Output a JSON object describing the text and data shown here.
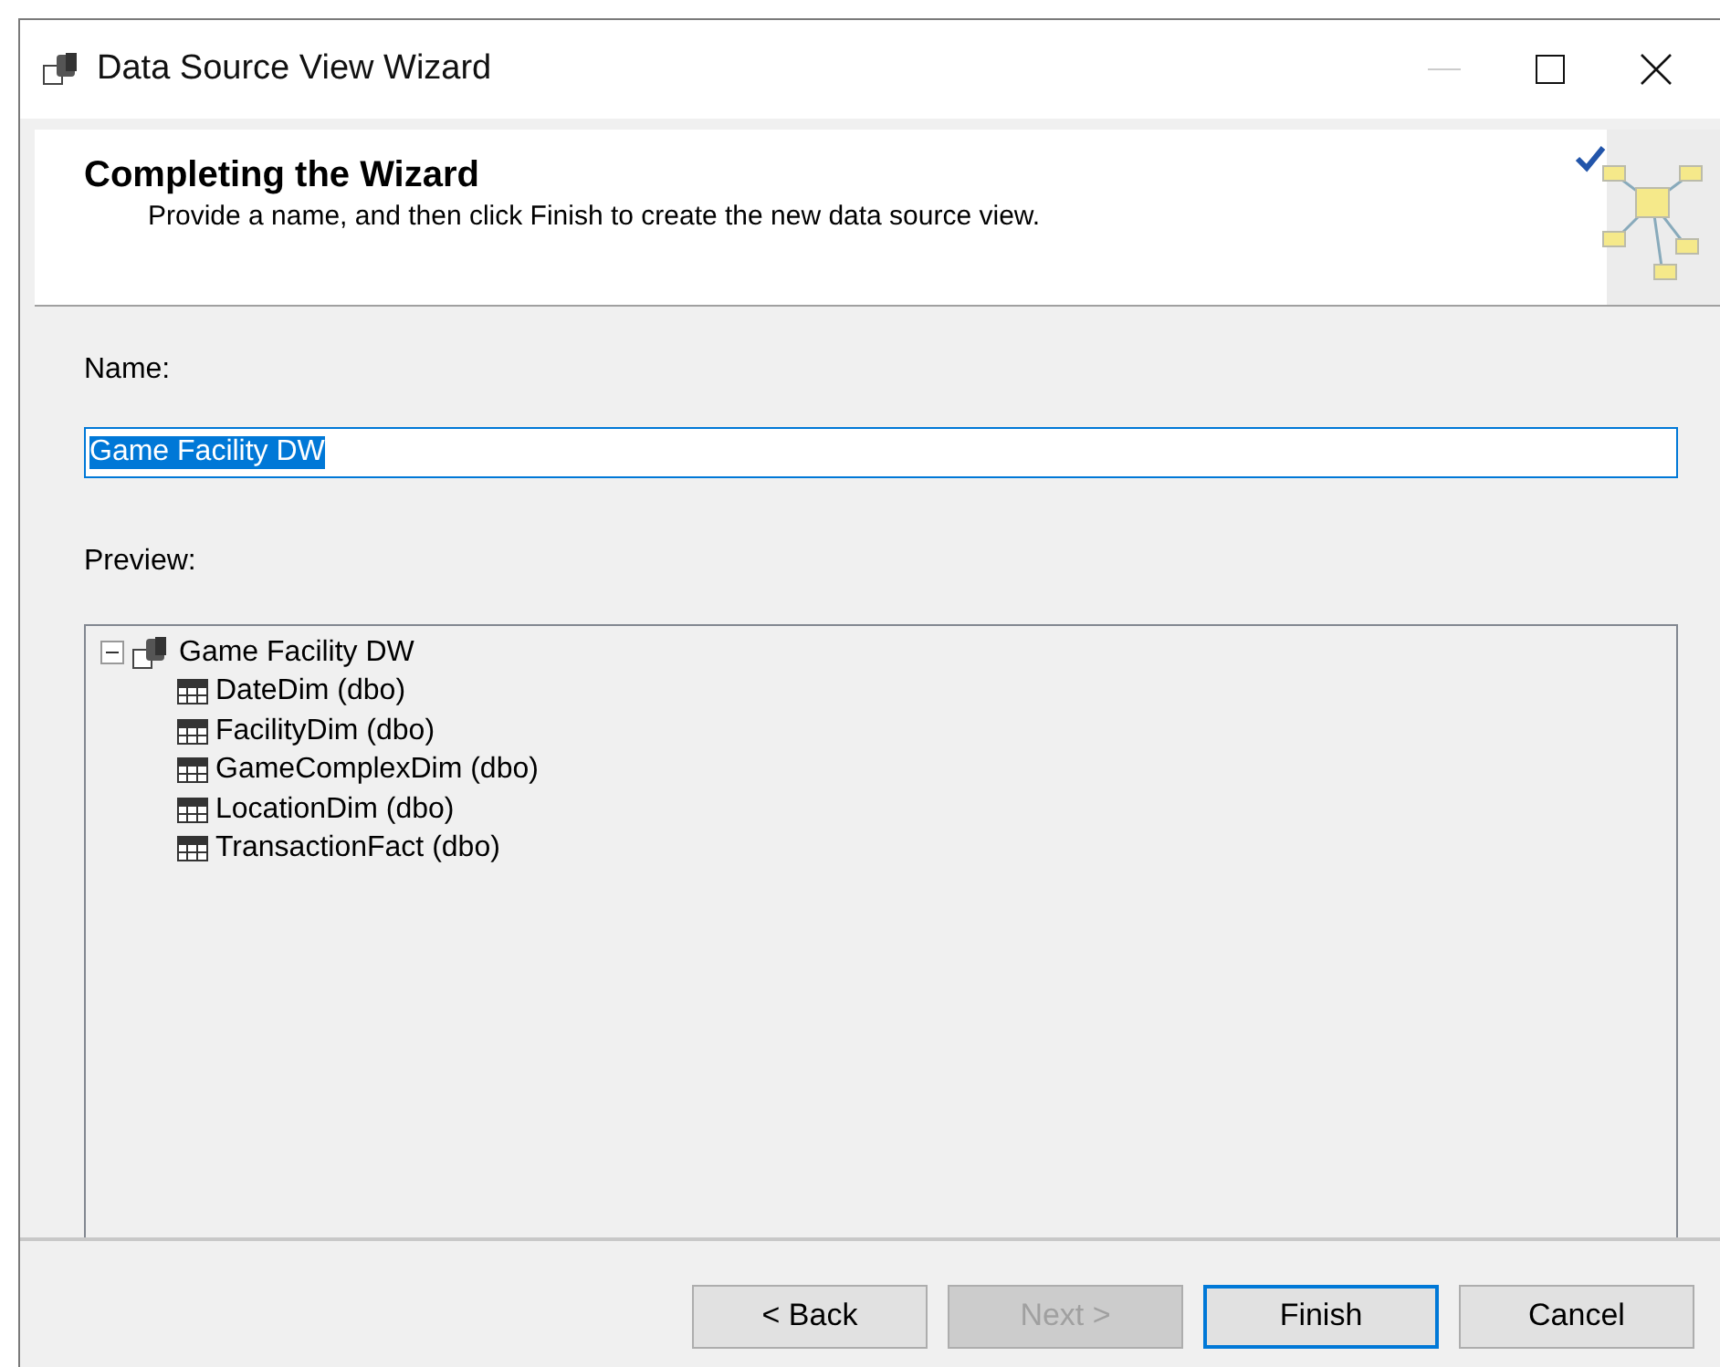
{
  "window": {
    "title": "Data Source View Wizard"
  },
  "header": {
    "title": "Completing the Wizard",
    "subtitle": "Provide a name, and then click Finish to create the new data source view."
  },
  "name_field": {
    "label": "Name:",
    "value": "Game Facility DW",
    "text_selected": true
  },
  "preview": {
    "label": "Preview:",
    "tree": [
      {
        "label": "Game Facility DW",
        "kind": "view",
        "expanded": true,
        "children": [
          {
            "label": "DateDim (dbo)",
            "kind": "table"
          },
          {
            "label": "FacilityDim (dbo)",
            "kind": "table"
          },
          {
            "label": "GameComplexDim (dbo)",
            "kind": "table"
          },
          {
            "label": "LocationDim (dbo)",
            "kind": "table"
          },
          {
            "label": "TransactionFact (dbo)",
            "kind": "table"
          }
        ]
      }
    ]
  },
  "buttons": [
    {
      "label": "< Back",
      "disabled": false,
      "focused": false
    },
    {
      "label": "Next >",
      "disabled": true,
      "focused": false
    },
    {
      "label": "Finish",
      "disabled": false,
      "focused": true
    },
    {
      "label": "Cancel",
      "disabled": false,
      "focused": false
    }
  ]
}
